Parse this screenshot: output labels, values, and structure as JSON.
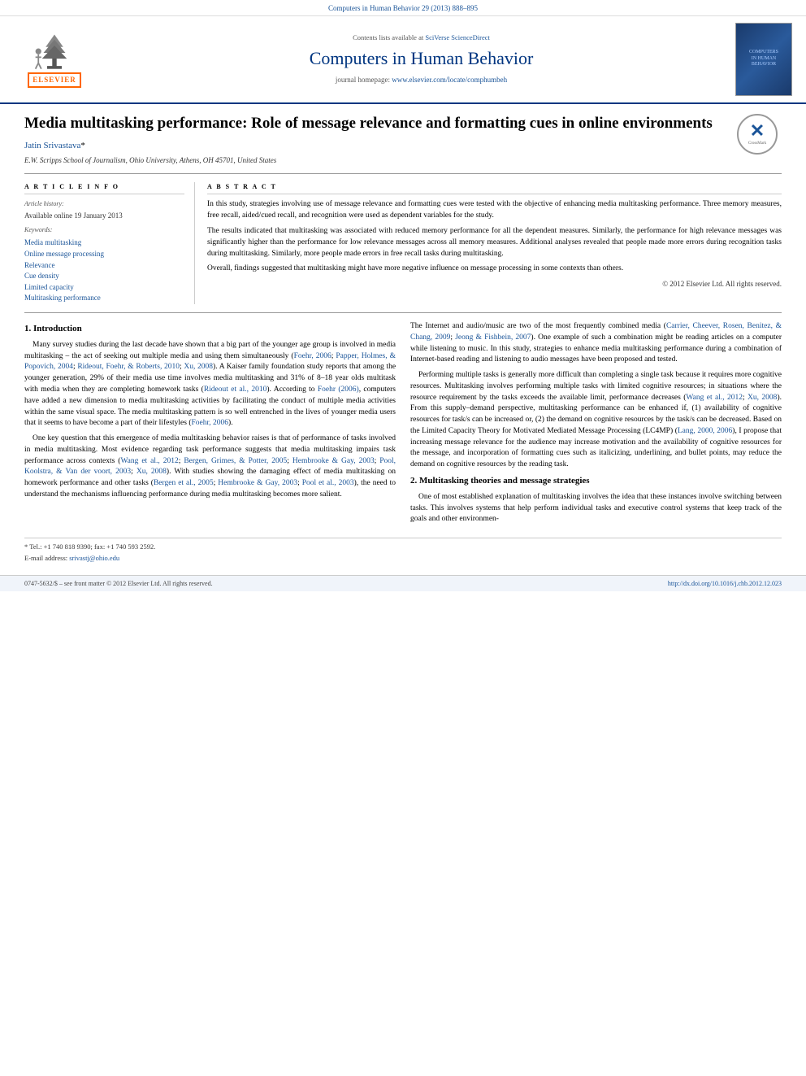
{
  "top_bar": {
    "journal_ref": "Computers in Human Behavior 29 (2013) 888–895"
  },
  "header": {
    "sciverse_text": "Contents lists available at ",
    "sciverse_link": "SciVerse ScienceDirect",
    "journal_title": "Computers in Human Behavior",
    "homepage_text": "journal homepage: ",
    "homepage_url": "www.elsevier.com/locate/comphumbeh",
    "elsevier_label": "ELSEVIER"
  },
  "article": {
    "title": "Media multitasking performance: Role of message relevance and formatting cues in online environments",
    "author": "Jatin Srivastava",
    "author_star": "*",
    "affiliation": "E.W. Scripps School of Journalism, Ohio University, Athens, OH 45701, United States",
    "crossmark_label": "CrossMark"
  },
  "article_info": {
    "section_label": "A R T I C L E   I N F O",
    "history_label": "Article history:",
    "available_online": "Available online 19 January 2013",
    "keywords_label": "Keywords:",
    "keywords": [
      "Media multitasking",
      "Online message processing",
      "Relevance",
      "Cue density",
      "Limited capacity",
      "Multitasking performance"
    ]
  },
  "abstract": {
    "section_label": "A B S T R A C T",
    "paragraphs": [
      "In this study, strategies involving use of message relevance and formatting cues were tested with the objective of enhancing media multitasking performance. Three memory measures, free recall, aided/cued recall, and recognition were used as dependent variables for the study.",
      "The results indicated that multitasking was associated with reduced memory performance for all the dependent measures. Similarly, the performance for high relevance messages was significantly higher than the performance for low relevance messages across all memory measures. Additional analyses revealed that people made more errors during recognition tasks during multitasking. Similarly, more people made errors in free recall tasks during multitasking.",
      "Overall, findings suggested that multitasking might have more negative influence on message processing in some contexts than others."
    ],
    "copyright": "© 2012 Elsevier Ltd. All rights reserved."
  },
  "section1": {
    "number": "1.",
    "title": "Introduction",
    "paragraphs": [
      "Many survey studies during the last decade have shown that a big part of the younger age group is involved in media multitasking – the act of seeking out multiple media and using them simultaneously (Foehr, 2006; Papper, Holmes, & Popovich, 2004; Rideout, Foehr, & Roberts, 2010; Xu, 2008). A Kaiser family foundation study reports that among the younger generation, 29% of their media use time involves media multitasking and 31% of 8–18 year olds multitask with media when they are completing homework tasks (Rideout et al., 2010). According to Foehr (2006), computers have added a new dimension to media multitasking activities by facilitating the conduct of multiple media activities within the same visual space. The media multitasking pattern is so well entrenched in the lives of younger media users that it seems to have become a part of their lifestyles (Foehr, 2006).",
      "One key question that this emergence of media multitasking behavior raises is that of performance of tasks involved in media multitasking. Most evidence regarding task performance suggests that media multitasking impairs task performance across contexts (Wang et al., 2012; Bergen, Grimes, & Potter, 2005; Hembrooke & Gay, 2003; Pool, Koolstra, & Van der voort, 2003; Xu, 2008). With studies showing the damaging effect of media multitasking on homework performance and other tasks (Bergen et al., 2005; Hembrooke & Gay, 2003; Pool et al., 2003), the need to understand the mechanisms influencing performance during media multitasking becomes more salient."
    ]
  },
  "section1_right": {
    "paragraphs": [
      "The Internet and audio/music are two of the most frequently combined media (Carrier, Cheever, Rosen, Benitez, & Chang, 2009; Jeong & Fishbein, 2007). One example of such a combination might be reading articles on a computer while listening to music. In this study, strategies to enhance media multitasking performance during a combination of Internet-based reading and listening to audio messages have been proposed and tested.",
      "Performing multiple tasks is generally more difficult than completing a single task because it requires more cognitive resources. Multitasking involves performing multiple tasks with limited cognitive resources; in situations where the resource requirement by the tasks exceeds the available limit, performance decreases (Wang et al., 2012; Xu, 2008). From this supply–demand perspective, multitasking performance can be enhanced if, (1) availability of cognitive resources for task/s can be increased or, (2) the demand on cognitive resources by the task/s can be decreased. Based on the Limited Capacity Theory for Motivated Mediated Message Processing (LC4MP) (Lang, 2000, 2006), I propose that increasing message relevance for the audience may increase motivation and the availability of cognitive resources for the message, and incorporation of formatting cues such as italicizing, underlining, and bullet points, may reduce the demand on cognitive resources by the reading task."
    ]
  },
  "section2": {
    "number": "2.",
    "title": "Multitasking theories and message strategies",
    "paragraphs": [
      "One of most established explanation of multitasking involves the idea that these instances involve switching between tasks. This involves systems that help perform individual tasks and executive control systems that keep track of the goals and other environmen-"
    ]
  },
  "footer": {
    "star_note": "* Tel.: +1 740 818 9390; fax: +1 740 593 2592.",
    "email_label": "E-mail address: ",
    "email": "srivastj@ohio.edu",
    "copyright_bottom": "0747-5632/$ – see front matter © 2012 Elsevier Ltd. All rights reserved.",
    "doi": "http://dx.doi.org/10.1016/j.chb.2012.12.023"
  }
}
